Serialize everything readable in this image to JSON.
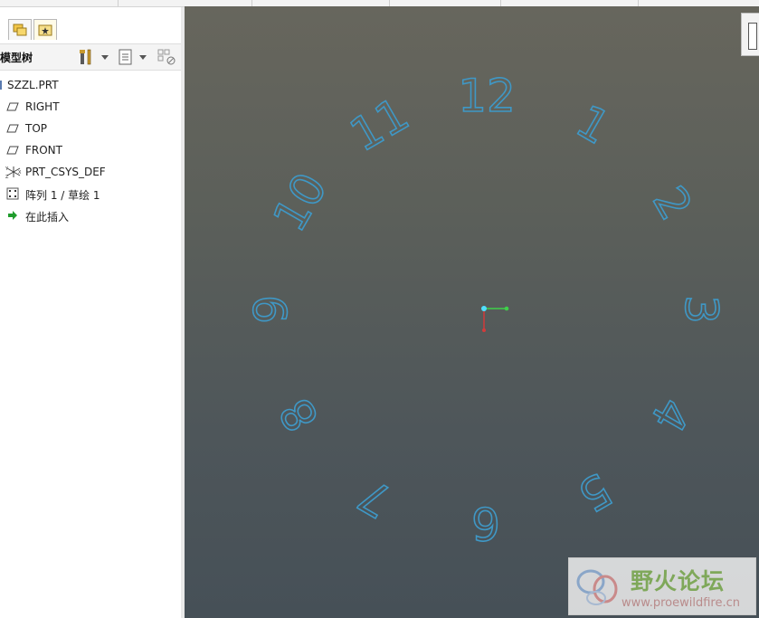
{
  "panel": {
    "title": "模型树",
    "settings_icon": "tree-settings-icon",
    "columns_icon": "tree-columns-icon",
    "filter_icon": "tree-filter-icon"
  },
  "tabs": [
    {
      "name": "layer-tab",
      "icon": "folders-icon"
    },
    {
      "name": "favorites-tab",
      "icon": "star-folder-icon"
    }
  ],
  "tree": {
    "items": [
      {
        "label": "SZZL.PRT",
        "icon": "part-icon"
      },
      {
        "label": "RIGHT",
        "icon": "datum-plane-icon"
      },
      {
        "label": "TOP",
        "icon": "datum-plane-icon"
      },
      {
        "label": "FRONT",
        "icon": "datum-plane-icon"
      },
      {
        "label": "PRT_CSYS_DEF",
        "icon": "coordinate-system-icon"
      },
      {
        "label": "阵列 1 / 草绘 1",
        "icon": "pattern-icon"
      },
      {
        "label": "在此插入",
        "icon": "insert-arrow-icon"
      }
    ]
  },
  "viewport": {
    "clock_numbers": [
      "12",
      "1",
      "2",
      "3",
      "4",
      "5",
      "6",
      "7",
      "8",
      "9",
      "10",
      "11"
    ],
    "number_color": "#3f98c6",
    "axis_x_color": "#3fd04a",
    "axis_y_color": "#d23b3b",
    "origin_color": "#4fe0ff"
  },
  "watermark": {
    "title": "野火论坛",
    "url": "www.proewildfire.cn"
  }
}
